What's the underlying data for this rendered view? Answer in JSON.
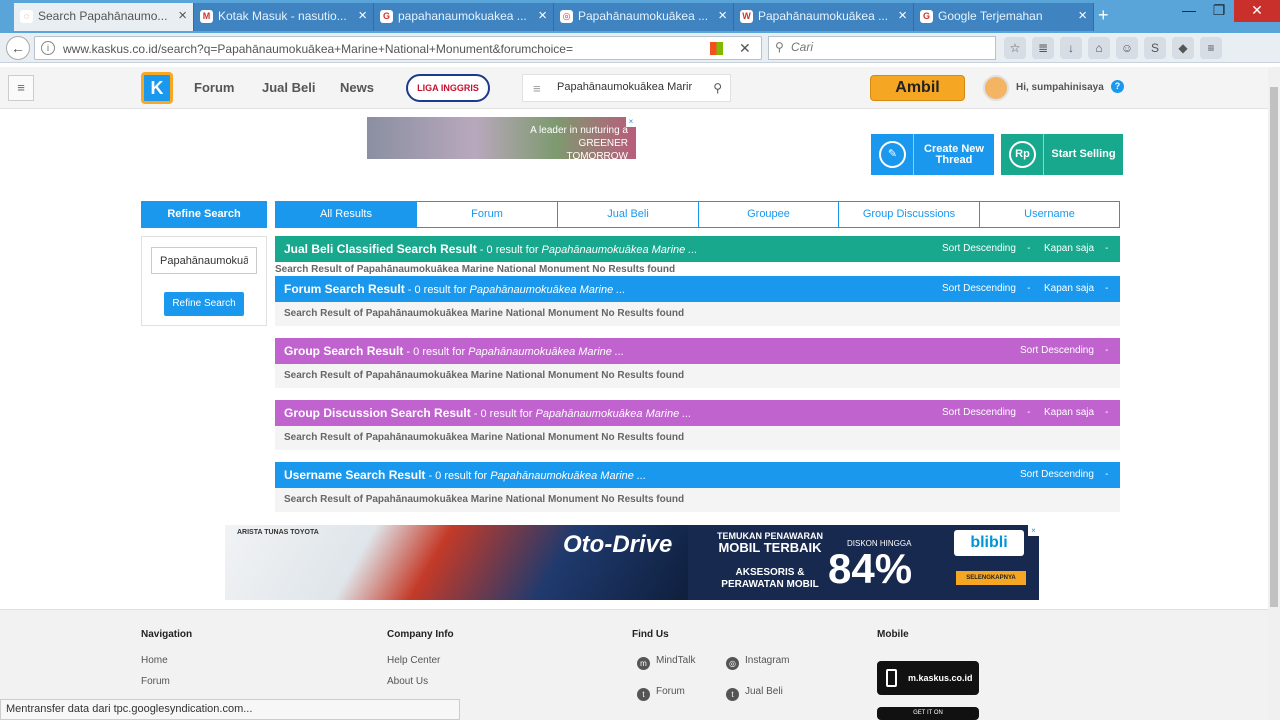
{
  "browser": {
    "tabs": [
      {
        "title": "Search Papahānaumo...",
        "active": true
      },
      {
        "title": "Kotak Masuk - nasutio...",
        "active": false
      },
      {
        "title": "papahanaumokuakea ...",
        "active": false
      },
      {
        "title": "Papahānaumokuākea ...",
        "active": false
      },
      {
        "title": "Papahānaumokuākea ...",
        "active": false
      },
      {
        "title": "Google Terjemahan",
        "active": false
      }
    ],
    "url": "www.kaskus.co.id/search?q=Papahānaumokuākea+Marine+National+Monument&forumchoice=",
    "search_placeholder": "Cari",
    "status_text": "Mentransfer data dari tpc.googlesyndication.com..."
  },
  "header": {
    "logo_text": "K",
    "nav": [
      "Forum",
      "Jual Beli",
      "News"
    ],
    "liga_text": "LIGA INGGRIS",
    "search_value": "Papahānaumokuākea Marir",
    "ambil_label": "Ambil",
    "greeting": "Hi, sumpahinisaya",
    "help": "?"
  },
  "ads": {
    "top_text": "A leader in nurturing a GREENER TOMORROW",
    "bottom": {
      "brands": "ARISTA   TUNAS TOYOTA",
      "title": "Oto-Drive",
      "promo_line1": "TEMUKAN PENAWARAN",
      "promo_line2": "MOBIL TERBAIK",
      "promo_line3": "AKSESORIS & PERAWATAN MOBIL",
      "discount_label": "DISKON HINGGA",
      "discount_value": "84%",
      "store": "blibli",
      "cta": "SELENGKAPNYA"
    }
  },
  "actions": {
    "create_thread": "Create New Thread",
    "start_selling": "Start Selling"
  },
  "refine": {
    "title": "Refine Search",
    "input_value": "Papahānaumokuākea",
    "button": "Refine Search"
  },
  "tabs": [
    "All Results",
    "Forum",
    "Jual Beli",
    "Groupee",
    "Group Discussions",
    "Username"
  ],
  "sections": {
    "jualbeli": {
      "title": "Jual Beli Classified Search Result",
      "count": " - 0 result for ",
      "query": "Papahānaumokuākea Marine ...",
      "sort": "Sort Descending",
      "time": "Kapan saja",
      "empty": "Search Result of Papahānaumokuākea Marine National Monument No Results found"
    },
    "forum": {
      "title": "Forum Search Result",
      "count": " - 0 result for ",
      "query": "Papahānaumokuākea Marine ...",
      "sort": "Sort Descending",
      "time": "Kapan saja",
      "empty": "Search Result of Papahānaumokuākea Marine National Monument No Results found"
    },
    "group": {
      "title": "Group Search Result",
      "count": " - 0 result for ",
      "query": "Papahānaumokuākea Marine ...",
      "sort": "Sort Descending",
      "empty": "Search Result of Papahānaumokuākea Marine National Monument No Results found"
    },
    "groupdisc": {
      "title": "Group Discussion Search Result",
      "count": " - 0 result for ",
      "query": "Papahānaumokuākea Marine ...",
      "sort": "Sort Descending",
      "time": "Kapan saja",
      "empty": "Search Result of Papahānaumokuākea Marine National Monument No Results found"
    },
    "username": {
      "title": "Username Search Result",
      "count": " - 0 result for ",
      "query": "Papahānaumokuākea Marine ...",
      "sort": "Sort Descending",
      "empty": "Search Result of Papahānaumokuākea Marine National Monument No Results found"
    }
  },
  "footer": {
    "navigation": {
      "title": "Navigation",
      "links": [
        "Home",
        "Forum"
      ]
    },
    "company": {
      "title": "Company Info",
      "links": [
        "Help Center",
        "About Us"
      ]
    },
    "findus": {
      "title": "Find Us",
      "links": [
        "MindTalk",
        "Instagram",
        "Forum",
        "Jual Beli"
      ]
    },
    "mobile": {
      "title": "Mobile",
      "badge": "m.kaskus.co.id",
      "getit": "GET IT ON"
    }
  }
}
